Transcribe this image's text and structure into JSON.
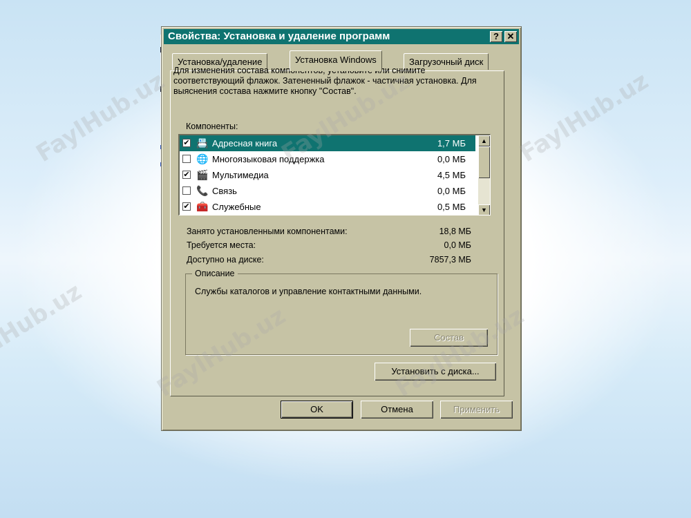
{
  "watermark": "FaylHub.uz",
  "dialog": {
    "title": "Свойства: Установка и удаление программ",
    "help_btn": "?",
    "close_btn": "✕",
    "tabs": [
      {
        "label": "Установка/удаление"
      },
      {
        "label": "Установка Windows"
      },
      {
        "label": "Загрузочный диск"
      }
    ],
    "intro_text": "Для изменения состава компонентов, установите или снимите соответствующий флажок. Затененный флажок - частичная установка. Для выяснения состава нажмите кнопку \"Состав\".",
    "components_label": "Компоненты:",
    "components": [
      {
        "name": "Адресная книга",
        "size": "1,7 МБ",
        "checked": true,
        "icon": "address-book-icon",
        "glyph": "📇"
      },
      {
        "name": "Многоязыковая поддержка",
        "size": "0,0 МБ",
        "checked": false,
        "icon": "globe-icon",
        "glyph": "🌐"
      },
      {
        "name": "Мультимедиа",
        "size": "4,5 МБ",
        "checked": true,
        "icon": "multimedia-icon",
        "glyph": "🎬"
      },
      {
        "name": "Связь",
        "size": "0,0 МБ",
        "checked": false,
        "icon": "phone-icon",
        "glyph": "📞"
      },
      {
        "name": "Служебные",
        "size": "0,5 МБ",
        "checked": true,
        "icon": "tools-icon",
        "glyph": "🧰"
      }
    ],
    "stats": {
      "installed_label": "Занято установленными компонентами:",
      "installed_value": "18,8 МБ",
      "required_label": "Требуется места:",
      "required_value": "0,0 МБ",
      "available_label": "Доступно на диске:",
      "available_value": "7857,3 МБ"
    },
    "description": {
      "legend": "Описание",
      "text": "Службы каталогов и управление контактными данными."
    },
    "buttons": {
      "details": "Состав",
      "install_from_disk": "Установить с диска...",
      "ok": "OK",
      "cancel": "Отмена",
      "apply": "Применить"
    }
  },
  "colors": {
    "title_bar": "#0f7370",
    "dialog_face": "#c6c3a5",
    "selection": "#0f7370"
  }
}
